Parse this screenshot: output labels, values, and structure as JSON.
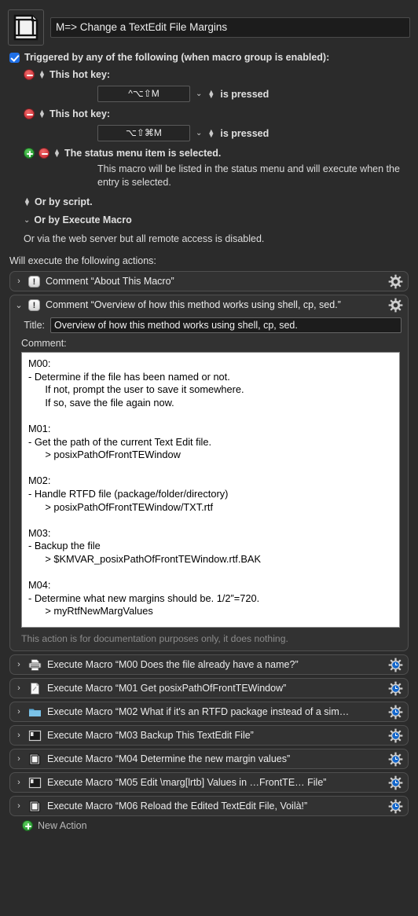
{
  "header": {
    "icon_name": "macro-margins-icon",
    "macro_name": "M=> Change a TextEdit File Margins"
  },
  "triggers": {
    "checkbox_checked": true,
    "heading": "Triggered by any of the following (when macro group is enabled):",
    "items": [
      {
        "label": "This hot key:",
        "hotkey": "^⌥⇧M",
        "suffix": "is pressed"
      },
      {
        "label": "This hot key:",
        "hotkey": "⌥⇧⌘M",
        "suffix": "is pressed"
      }
    ],
    "status_menu_label": "The status menu item is selected.",
    "status_menu_note": "This macro will be listed in the status menu and will execute when the entry is selected.",
    "or_by_script": "Or by script.",
    "or_by_execute_macro": "Or by Execute Macro",
    "web_server_note": "Or via the web server but all remote access is disabled."
  },
  "actions_header": "Will execute the following actions:",
  "actions": [
    {
      "name": "comment-about-this-macro",
      "icon": "exclamation-icon",
      "title": "Comment “About This Macro”",
      "expanded": false,
      "gear": "gear-icon"
    },
    {
      "name": "comment-overview",
      "icon": "exclamation-icon",
      "title": "Comment “Overview of how this method works using shell, cp, sed.”",
      "expanded": true,
      "gear": "gear-icon",
      "title_field_label": "Title:",
      "title_field_value": "Overview of how this method works using shell, cp, sed.",
      "comment_field_label": "Comment:",
      "comment_text": "M00:\n- Determine if the file has been named or not.\n      If not, prompt the user to save it somewhere.\n      If so, save the file again now.\n\nM01:\n- Get the path of the current Text Edit file.\n      > posixPathOfFrontTEWindow\n\nM02:\n- Handle RTFD file (package/folder/directory)\n      > posixPathOfFrontTEWindow/TXT.rtf\n\nM03:\n- Backup the file\n      > $KMVAR_posixPathOfFrontTEWindow.rtf.BAK\n\nM04:\n- Determine what new margins should be. 1/2”=720.\n      > myRtfNewMargValues",
      "footer_note": "This action is for documentation purposes only, it does nothing."
    },
    {
      "name": "execute-macro-m00",
      "icon": "save-printer-icon",
      "title": "Execute Macro “M00 Does the file already have a name?”",
      "expanded": false,
      "gear": "gear-clock-icon"
    },
    {
      "name": "execute-macro-m01",
      "icon": "document-icon",
      "title": "Execute Macro “M01 Get posixPathOfFrontTEWindow”",
      "expanded": false,
      "gear": "gear-clock-icon"
    },
    {
      "name": "execute-macro-m02",
      "icon": "blue-folder-icon",
      "title": "Execute Macro “M02 What if it's an RTFD package instead of a sim…",
      "expanded": false,
      "gear": "gear-clock-icon"
    },
    {
      "name": "execute-macro-m03",
      "icon": "terminal-icon",
      "title": "Execute Macro “M03 Backup This TextEdit File”",
      "expanded": false,
      "gear": "gear-clock-icon"
    },
    {
      "name": "execute-macro-m04",
      "icon": "margins-doc-icon",
      "title": "Execute Macro “M04 Determine the new margin values”",
      "expanded": false,
      "gear": "gear-clock-icon"
    },
    {
      "name": "execute-macro-m05",
      "icon": "terminal-icon",
      "title": "Execute Macro “M05 Edit \\marg[lrtb] Values in …FrontTE… File”",
      "expanded": false,
      "gear": "gear-clock-icon"
    },
    {
      "name": "execute-macro-m06",
      "icon": "margins-doc-icon",
      "title": "Execute Macro “M06 Reload the Edited TextEdit File, Voilà!”",
      "expanded": false,
      "gear": "gear-clock-icon"
    }
  ],
  "new_action_label": "New Action",
  "colors": {
    "background": "#2b2b2b",
    "action_panel": "#323232",
    "accent_blue": "#1f6fe5",
    "gear_blue": "#1266cc",
    "remove_red": "#c41e28",
    "add_green": "#138a22"
  }
}
